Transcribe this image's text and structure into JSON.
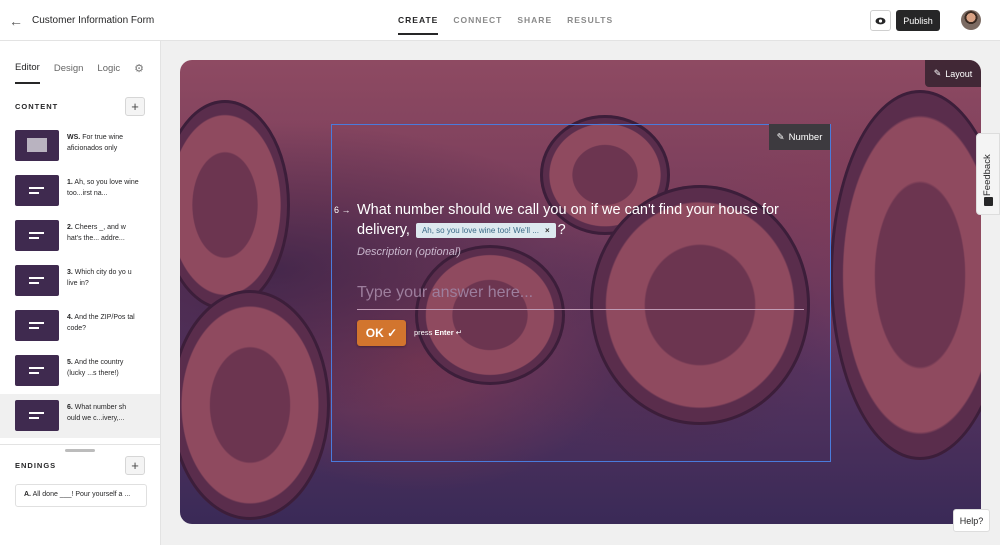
{
  "header": {
    "back_icon": "arrow-left-icon",
    "title": "Customer Information Form",
    "tabs": [
      "CREATE",
      "CONNECT",
      "SHARE",
      "RESULTS"
    ],
    "active_tab": "CREATE",
    "preview_icon": "eye-icon",
    "publish_label": "Publish"
  },
  "sidebar": {
    "tabs": [
      "Editor",
      "Design",
      "Logic"
    ],
    "active_tab": "Editor",
    "settings_icon": "gear-icon",
    "content_label": "CONTENT",
    "endings_label": "ENDINGS",
    "questions": [
      {
        "num": "WS.",
        "text": "For true wine aficionados only"
      },
      {
        "num": "1.",
        "text": "Ah, so you love wine too...irst na..."
      },
      {
        "num": "2.",
        "text": "Cheers _, and w hat's the... addre..."
      },
      {
        "num": "3.",
        "text": "Which city do yo u live in?"
      },
      {
        "num": "4.",
        "text": "And the ZIP/Pos tal code?"
      },
      {
        "num": "5.",
        "text": "And the country (lucky ...s there!)"
      },
      {
        "num": "6.",
        "text": "What number sh ould we c...ivery,..."
      }
    ],
    "ending": {
      "num": "A.",
      "text": "All done ___! Pour yourself a ..."
    }
  },
  "canvas": {
    "layout_label": "Layout",
    "number_label": "Number",
    "question_number": "6",
    "question_text_before": "What number should we call you on if we can't find your house for delivery,",
    "chip_text": "Ah, so you love wine too! We'll ...",
    "question_text_after": "?",
    "description_placeholder": "Description (optional)",
    "answer_placeholder": "Type your answer here...",
    "ok_label": "OK",
    "press_prefix": "press",
    "press_key": "Enter"
  },
  "side_widgets": {
    "feedback_label": "Feedback",
    "help_label": "Help?"
  },
  "colors": {
    "accent": "#d2752e",
    "selection": "#4a7bdc",
    "thumb": "#3f2a4f"
  }
}
